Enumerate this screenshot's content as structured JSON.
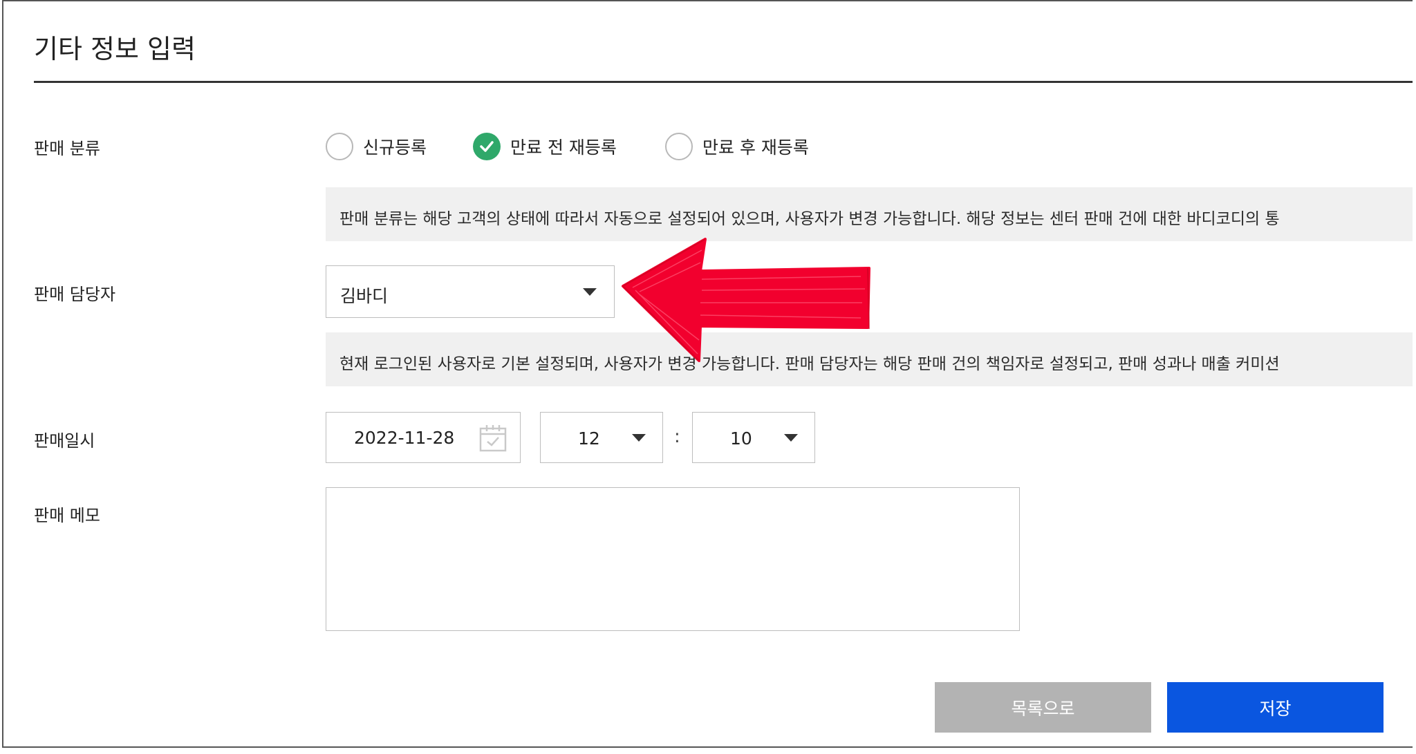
{
  "section_title": "기타 정보 입력",
  "sale_type": {
    "label": "판매 분류",
    "options": [
      {
        "label": "신규등록",
        "checked": false
      },
      {
        "label": "만료 전 재등록",
        "checked": true
      },
      {
        "label": "만료 후 재등록",
        "checked": false
      }
    ],
    "help": "판매 분류는 해당 고객의 상태에 따라서 자동으로 설정되어 있으며, 사용자가 변경 가능합니다. 해당 정보는 센터 판매 건에 대한 바디코디의 통"
  },
  "sales_rep": {
    "label": "판매 담당자",
    "value": "김바디",
    "help": "현재 로그인된 사용자로 기본 설정되며, 사용자가 변경 가능합니다. 판매 담당자는 해당 판매 건의 책임자로 설정되고, 판매 성과나 매출 커미션"
  },
  "sale_datetime": {
    "label": "판매일시",
    "date": "2022-11-28",
    "hour": "12",
    "minute": "10",
    "separator": ":"
  },
  "memo": {
    "label": "판매 메모",
    "value": "",
    "placeholder": ""
  },
  "buttons": {
    "list_label": "목록으로",
    "save_label": "저장"
  },
  "colors": {
    "checked": "#2fa86a",
    "save": "#0a56e0",
    "list": "#b3b3b3",
    "annotation_arrow": "#f2002e"
  },
  "icons": {
    "date": "calendar-icon",
    "select": "caret-down-icon",
    "check": "check-icon",
    "annotation": "red-arrow-annotation"
  }
}
